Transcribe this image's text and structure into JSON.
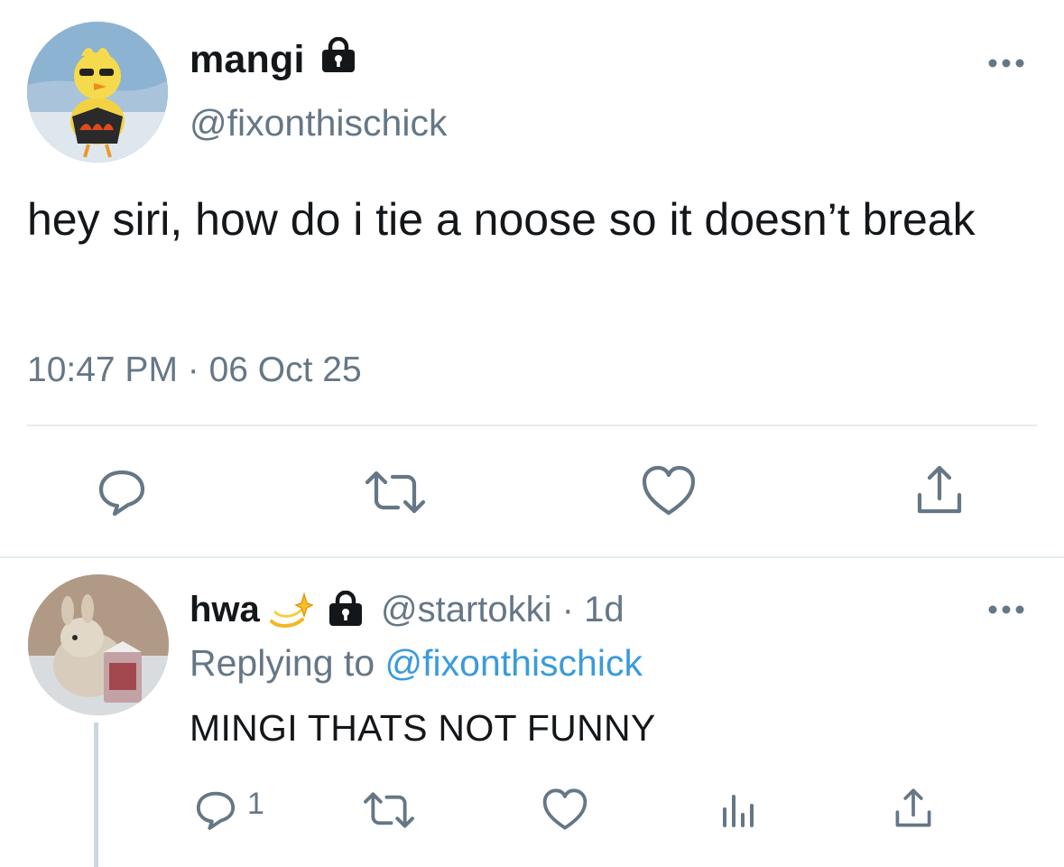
{
  "main_tweet": {
    "display_name": "mangi",
    "handle": "@fixonthischick",
    "text": "hey siri, how do i tie a noose so it doesn’t break",
    "timestamp": "10:47 PM · 06 Oct 25",
    "locked": true,
    "actions": [
      "reply-icon",
      "retweet-icon",
      "like-icon",
      "share-icon"
    ]
  },
  "reply_tweet": {
    "display_name": "hwa",
    "emoji": "💫",
    "handle": "@startokki",
    "meta_separator": " · ",
    "age": "1d",
    "replying_to_label": "Replying to",
    "replying_to_handle": "@fixonthischick",
    "text": "MINGI THATS NOT FUNNY",
    "reply_count": "1",
    "locked": true,
    "actions": [
      "reply-icon",
      "retweet-icon",
      "like-icon",
      "analytics-icon",
      "share-icon"
    ]
  },
  "colors": {
    "text": "#14171a",
    "secondary": "#657786",
    "link": "#3a9bdc",
    "divider": "#e6ecf0"
  }
}
